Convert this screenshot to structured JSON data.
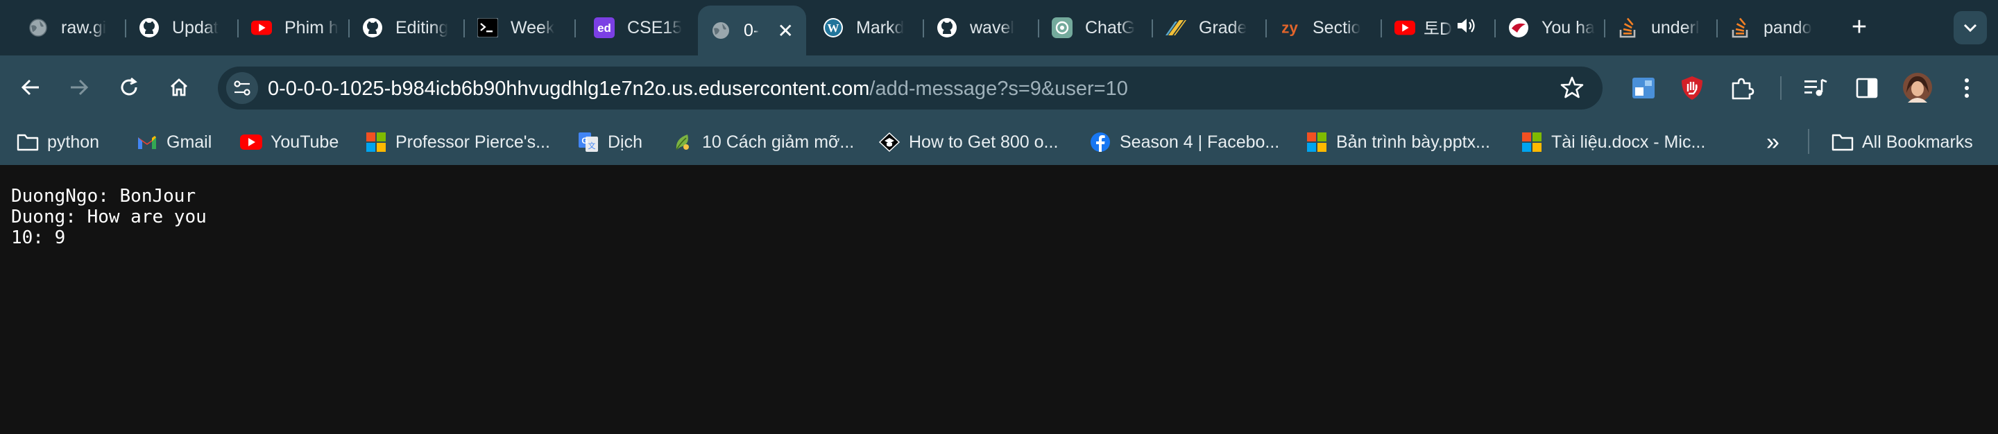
{
  "tabs": [
    {
      "label": "raw.gi",
      "icon": "globe-icon"
    },
    {
      "label": "Updat",
      "icon": "github-icon"
    },
    {
      "label": "Phim h",
      "icon": "youtube-icon"
    },
    {
      "label": "Editing",
      "icon": "github-icon"
    },
    {
      "label": "Week",
      "icon": "terminal-icon"
    },
    {
      "label": "CSE15",
      "icon": "ed-icon"
    },
    {
      "label": "0-",
      "icon": "globe-icon"
    },
    {
      "label": "Markd",
      "icon": "wordpress-icon"
    },
    {
      "label": "wavel",
      "icon": "github-icon"
    },
    {
      "label": "ChatG",
      "icon": "chatgpt-icon"
    },
    {
      "label": "Grade",
      "icon": "gradescope-icon"
    },
    {
      "label": "Sectio",
      "icon": "zybooks-icon"
    },
    {
      "label": "토D",
      "icon": "youtube-icon"
    },
    {
      "label": "You ha",
      "icon": "cornell-icon"
    },
    {
      "label": "underl",
      "icon": "stackoverflow-icon"
    },
    {
      "label": "pando",
      "icon": "stackoverflow-icon"
    }
  ],
  "address_bar": {
    "host": "0-0-0-0-1025-b984icb6b90hhvugdhlg1e7n2o.us.edusercontent.com",
    "path": "/add-message?s=9&user=10"
  },
  "bookmarks": [
    {
      "label": "python",
      "icon": "folder-icon"
    },
    {
      "label": "Gmail",
      "icon": "gmail-icon"
    },
    {
      "label": "YouTube",
      "icon": "youtube-icon"
    },
    {
      "label": "Professor Pierce's...",
      "icon": "microsoft-icon"
    },
    {
      "label": "Dịch",
      "icon": "google-translate-icon"
    },
    {
      "label": "10 Cách giảm mỡ...",
      "icon": "leaf-icon"
    },
    {
      "label": "How to Get 800 o...",
      "icon": "graduation-cap-icon"
    },
    {
      "label": "Season 4 | Facebo...",
      "icon": "facebook-icon"
    },
    {
      "label": "Bản trình bày.pptx...",
      "icon": "microsoft-icon"
    },
    {
      "label": "Tài liệu.docx - Mic...",
      "icon": "microsoft-icon"
    }
  ],
  "bookmarks_overflow": "»",
  "all_bookmarks": "All Bookmarks",
  "messages": [
    "DuongNgo: BonJour",
    "Duong: How are you",
    "10: 9"
  ],
  "colors": {
    "tabstrip": "#1a2f3a",
    "toolbar": "#2c4a58",
    "omnibox": "#1b323d",
    "page_bg": "#121212"
  }
}
